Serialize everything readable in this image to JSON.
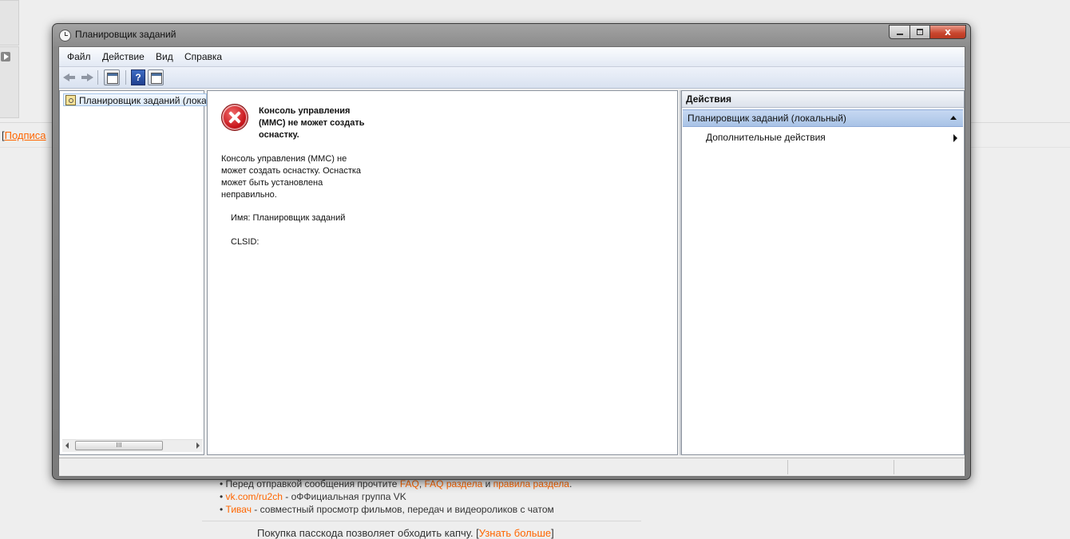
{
  "background_page": {
    "subscribe_bracket": "[",
    "subscribe_link": "Подписа",
    "notes": [
      {
        "prefix": "• Перед отправкой сообщения прочтите ",
        "links": [
          "FAQ",
          "FAQ раздела",
          "правила раздела"
        ],
        "separators": [
          ", ",
          " и ",
          "."
        ]
      },
      {
        "link": "vk.com/ru2ch",
        "text": " - оФФициальная группа VK"
      },
      {
        "link": "Тивач",
        "text": " - совместный просмотр фильмов, передач и видеороликов с чатом"
      }
    ],
    "passcode_text": "Покупка пасскода позволяет обходить капчу. [",
    "passcode_link": "Узнать больше",
    "passcode_close": "]"
  },
  "window": {
    "title": "Планировщик заданий",
    "close_glyph": "x"
  },
  "menu": {
    "file": "Файл",
    "action": "Действие",
    "view": "Вид",
    "help": "Справка"
  },
  "toolbar": {
    "help_glyph": "?"
  },
  "tree": {
    "root_label": "Планировщик заданий (локальный)",
    "scroll_thumb_glyph": "III"
  },
  "error": {
    "title": "Консоль управления (MMC) не может создать оснастку.",
    "body": "Консоль управления (MMC) не может создать оснастку. Оснастка может быть установлена неправильно.",
    "name_line": "Имя: Планировщик заданий",
    "clsid_line": "CLSID:"
  },
  "actions": {
    "header": "Действия",
    "section_title": "Планировщик заданий (локальный)",
    "more_actions": "Дополнительные действия"
  },
  "colors": {
    "link": "#ff6600",
    "selection": "#a9c3e6",
    "error_red": "#c8161c"
  }
}
